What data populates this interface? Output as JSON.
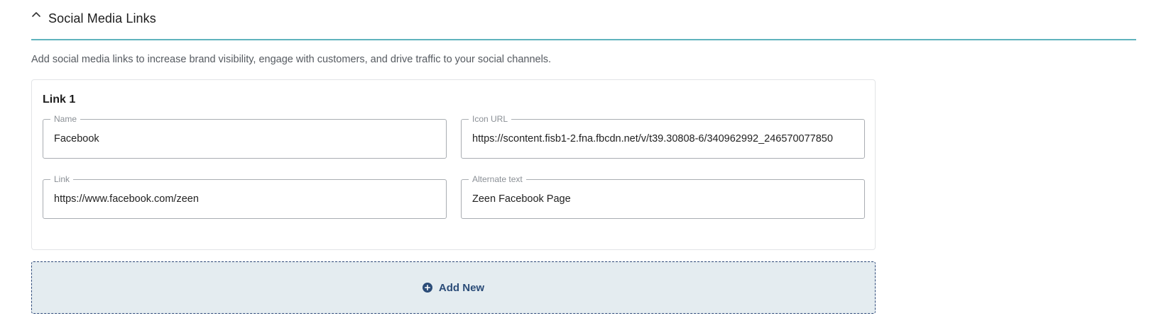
{
  "section": {
    "title": "Social Media Links",
    "description": "Add social media links to increase brand visibility, engage with customers, and drive traffic to your social channels."
  },
  "links": [
    {
      "title": "Link 1",
      "name": {
        "label": "Name",
        "value": "Facebook"
      },
      "icon_url": {
        "label": "Icon URL",
        "value": "https://scontent.fisb1-2.fna.fbcdn.net/v/t39.30808-6/340962992_246570077850"
      },
      "link": {
        "label": "Link",
        "value": "https://www.facebook.com/zeen"
      },
      "alt_text": {
        "label": "Alternate text",
        "value": "Zeen Facebook Page"
      }
    }
  ],
  "add_new": {
    "label": "Add New",
    "icon": "plus-circle-icon"
  },
  "icons": {
    "collapse": "chevron-up-icon"
  },
  "colors": {
    "header_underline": "#5fb3bd",
    "add_new_bg": "#e4ecf0",
    "add_new_text": "#2b4c78",
    "field_border": "#a9adb2"
  }
}
